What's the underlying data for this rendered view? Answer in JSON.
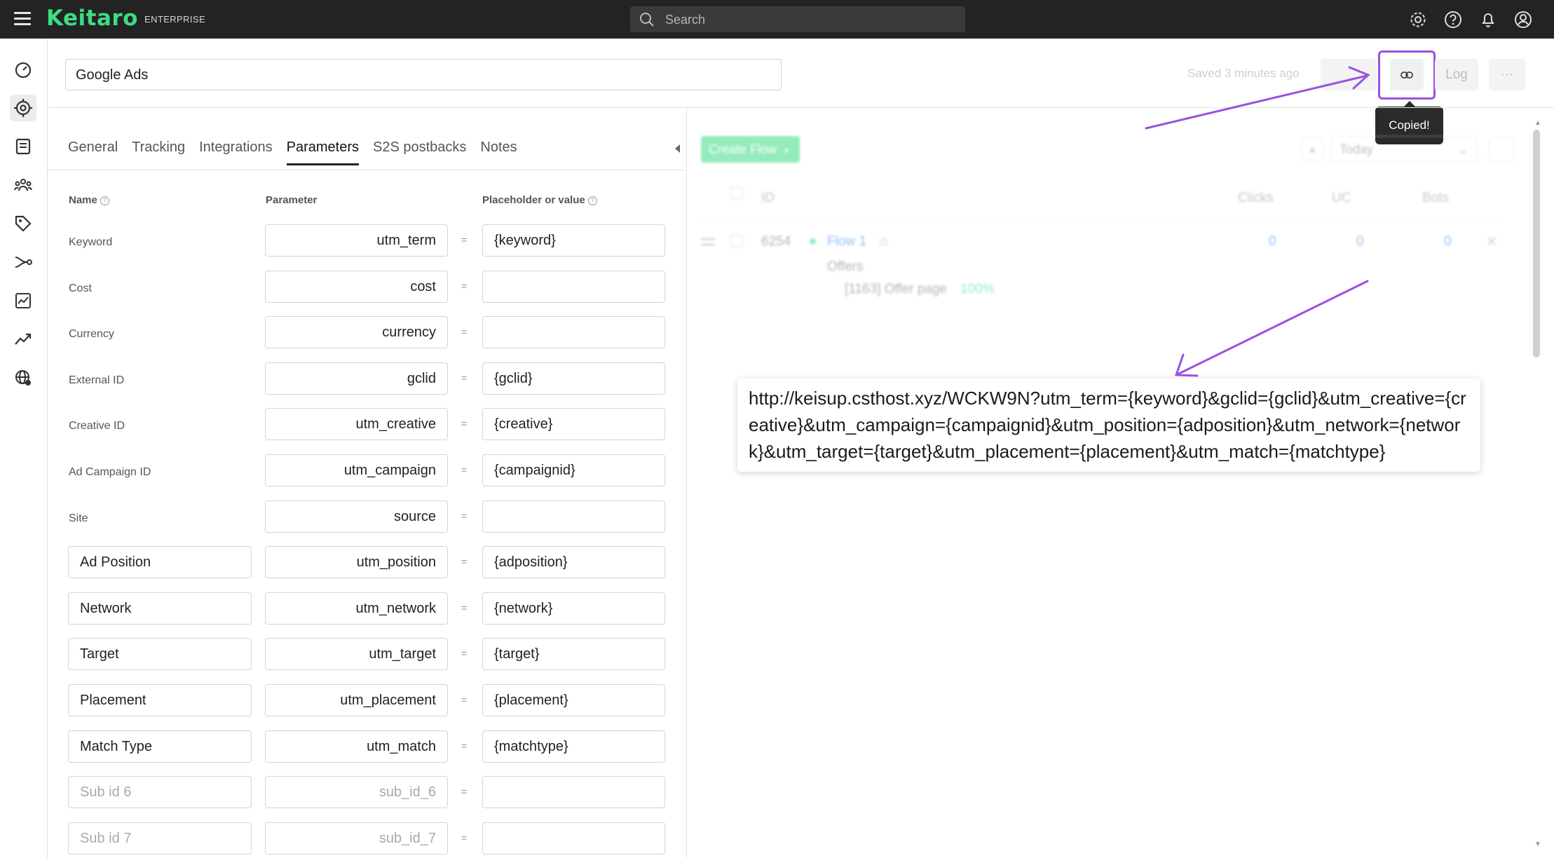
{
  "topbar": {
    "logo": "Keitaro",
    "logo_sub": "ENTERPRISE",
    "search_placeholder": "Search"
  },
  "campaign": {
    "name": "Google Ads",
    "saved_status": "Saved 3 minutes ago",
    "log_label": "Log",
    "more_label": "···",
    "tooltip": "Copied!"
  },
  "tabs": [
    "General",
    "Tracking",
    "Integrations",
    "Parameters",
    "S2S postbacks",
    "Notes"
  ],
  "params": {
    "headers": {
      "name": "Name",
      "parameter": "Parameter",
      "value": "Placeholder or value"
    },
    "rows": [
      {
        "name": "Keyword",
        "param": "utm_term",
        "value": "{keyword}"
      },
      {
        "name": "Cost",
        "param": "cost",
        "value": ""
      },
      {
        "name": "Currency",
        "param": "currency",
        "value": ""
      },
      {
        "name": "External ID",
        "param": "gclid",
        "value": "{gclid}"
      },
      {
        "name": "Creative ID",
        "param": "utm_creative",
        "value": "{creative}"
      },
      {
        "name": "Ad Campaign ID",
        "param": "utm_campaign",
        "value": "{campaignid}"
      },
      {
        "name": "Site",
        "param": "source",
        "value": ""
      },
      {
        "name": "Ad Position",
        "param": "utm_position",
        "value": "{adposition}"
      },
      {
        "name": "Network",
        "param": "utm_network",
        "value": "{network}"
      },
      {
        "name": "Target",
        "param": "utm_target",
        "value": "{target}"
      },
      {
        "name": "Placement",
        "param": "utm_placement",
        "value": "{placement}"
      },
      {
        "name": "Match Type",
        "param": "utm_match",
        "value": "{matchtype}"
      },
      {
        "name": "Sub id 6",
        "param": "sub_id_6",
        "value": ""
      },
      {
        "name": "Sub id 7",
        "param": "sub_id_7",
        "value": ""
      }
    ]
  },
  "flows": {
    "create_label": "Create Flow",
    "date_range": "Today",
    "columns": {
      "id": "ID",
      "clicks": "Clicks",
      "uc": "UC",
      "bots": "Bots"
    },
    "row": {
      "id": "6254",
      "name": "Flow 1",
      "offers_label": "Offers",
      "offer": "[1163] Offer page",
      "offer_share": "100%",
      "clicks": "0",
      "uc": "0",
      "bots": "0"
    }
  },
  "campaign_url": "http://keisup.csthost.xyz/WCKW9N?utm_term={keyword}&gclid={gclid}&utm_creative={creative}&utm_campaign={campaignid}&utm_position={adposition}&utm_network={network}&utm_target={target}&utm_placement={placement}&utm_match={matchtype}",
  "colors": {
    "brand": "#3ddc84",
    "annotation": "#9b51e0",
    "topbar": "#232323"
  }
}
